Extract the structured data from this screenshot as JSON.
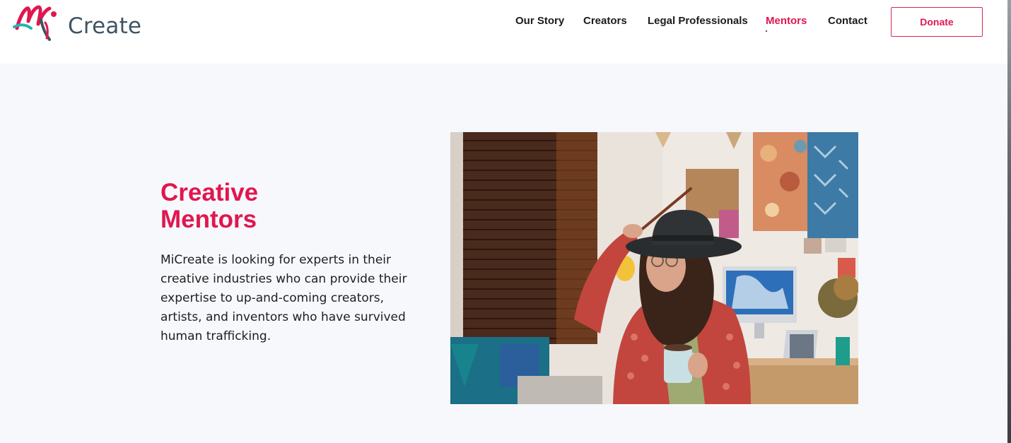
{
  "brand": {
    "logo_text": "Create",
    "colors": {
      "accent": "#e0174f",
      "logo_teal": "#1fb6b0",
      "logo_gray": "#3f5563",
      "section_bg": "#f7f8fc"
    }
  },
  "nav": {
    "items": [
      {
        "label": "Our Story",
        "active": false
      },
      {
        "label": "Creators",
        "active": false
      },
      {
        "label": "Legal Professionals",
        "active": false
      },
      {
        "label": "Mentors",
        "active": true
      },
      {
        "label": "Contact",
        "active": false
      }
    ],
    "donate_label": "Donate"
  },
  "hero": {
    "title_line1": "Creative",
    "title_line2": "Mentors",
    "body": "MiCreate is looking for experts in their creative industries who can provide their expertise to up-and-coming creators, artists, and inventors who have survived human trafficking."
  },
  "photo": {
    "icon": "woman-with-hat-in-studio-photo"
  }
}
